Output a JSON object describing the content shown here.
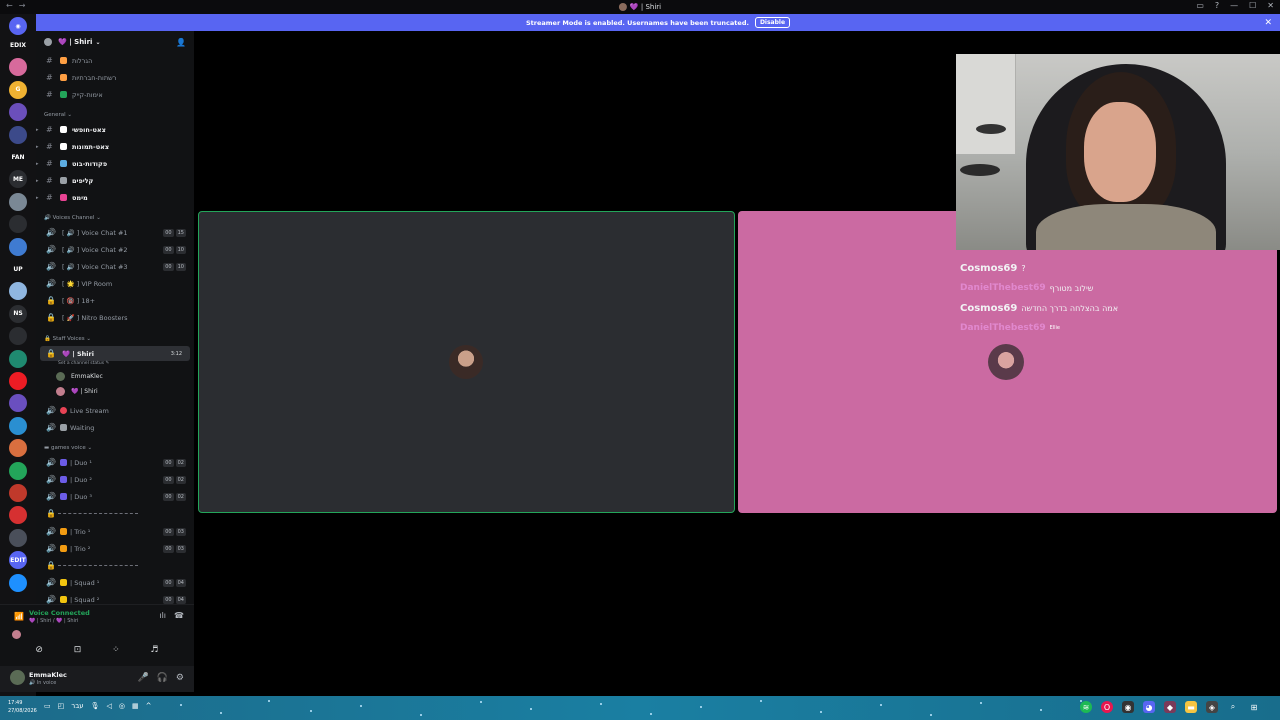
{
  "window": {
    "title": "💜 | Shiri",
    "controls": [
      "▭",
      "?",
      "—",
      "☐",
      "✕"
    ]
  },
  "banner": {
    "text": "Streamer Mode is enabled. Usernames have been truncated.",
    "button": "Disable"
  },
  "rail": {
    "servers": [
      {
        "label": "",
        "color": "#5865f2"
      },
      {
        "label": "EDIX",
        "color": "#121214"
      },
      {
        "label": "",
        "color": "#d76a9c"
      },
      {
        "label": "G",
        "color": "#f0b232"
      },
      {
        "label": "",
        "color": "#6b4fbb"
      },
      {
        "label": "",
        "color": "#3c4a8a"
      },
      {
        "label": "FAN",
        "color": "#121214"
      },
      {
        "label": "ME",
        "color": "#2b2d31"
      },
      {
        "label": "",
        "color": "#7a8895"
      },
      {
        "label": "",
        "color": "#2b2d31"
      },
      {
        "label": "",
        "color": "#3f7bd1"
      },
      {
        "label": "UP",
        "color": "#121214"
      },
      {
        "label": "",
        "color": "#8fb6e0"
      },
      {
        "label": "NS",
        "color": "#2b2d31"
      },
      {
        "label": "",
        "color": "#2b2d31"
      },
      {
        "label": "",
        "color": "#1f8a70"
      },
      {
        "label": "",
        "color": "#ed1c24"
      },
      {
        "label": "",
        "color": "#6a4fbf"
      },
      {
        "label": "",
        "color": "#2a8fd1"
      },
      {
        "label": "",
        "color": "#d96f3f"
      },
      {
        "label": "",
        "color": "#23a55a"
      },
      {
        "label": "",
        "color": "#c0392b"
      },
      {
        "label": "",
        "color": "#d63031"
      },
      {
        "label": "",
        "color": "#4a4f5a"
      },
      {
        "label": "EDIT",
        "color": "#5865f2"
      },
      {
        "label": "",
        "color": "#1e90ff"
      }
    ]
  },
  "server": {
    "name": "💜 | Shiri"
  },
  "channels": {
    "top": [
      {
        "label": "הגרלות",
        "color": "#ff9f43"
      },
      {
        "label": "רשתות-חברתיות",
        "color": "#ff9f43"
      },
      {
        "label": "אימות-קייק",
        "color": "#23a55a"
      }
    ],
    "general_cat": "General",
    "general": [
      {
        "label": "צאט-חופשי",
        "color": "#ffffff"
      },
      {
        "label": "צאט-תמונות",
        "color": "#ffffff"
      },
      {
        "label": "פקודות-בוט",
        "color": "#5dade2"
      },
      {
        "label": "קליפים",
        "color": "#9aa0a6"
      },
      {
        "label": "מימס",
        "color": "#e84393"
      }
    ],
    "voices_cat": "Voices Channel",
    "voices": [
      {
        "label": "[ 🔊 ] Voice Chat #1",
        "c1": "00",
        "c2": "15"
      },
      {
        "label": "[ 🔊 ] Voice Chat #2",
        "c1": "00",
        "c2": "10"
      },
      {
        "label": "[ 🔊 ] Voice Chat #3",
        "c1": "00",
        "c2": "10"
      },
      {
        "label": "[ 🌟 ] VIP Room",
        "c1": "",
        "c2": ""
      },
      {
        "label": "[ 🔞 ] 18+",
        "c1": "",
        "c2": ""
      },
      {
        "label": "[ 🚀 ] Nitro Boosters",
        "c1": "",
        "c2": ""
      }
    ],
    "staff_cat": "Staff Voices",
    "shiri": {
      "label": "💜 | Shiri",
      "time": "3:12",
      "status": "Set a channel status ✎"
    },
    "members": [
      "EmmaKlec",
      "💜 | Shiri"
    ],
    "live": "Live Stream",
    "waiting": "Waiting",
    "games_cat": "games voice",
    "games": [
      {
        "label": "| Duo ¹",
        "c1": "00",
        "c2": "02"
      },
      {
        "label": "| Duo ²",
        "c1": "00",
        "c2": "02"
      },
      {
        "label": "| Duo ³",
        "c1": "00",
        "c2": "02"
      },
      {
        "label": "| Trio ¹",
        "c1": "00",
        "c2": "03"
      },
      {
        "label": "| Trio ²",
        "c1": "00",
        "c2": "03"
      },
      {
        "label": "| Squad ¹",
        "c1": "00",
        "c2": "04"
      },
      {
        "label": "| Squad ²",
        "c1": "00",
        "c2": "04"
      }
    ]
  },
  "voice": {
    "status": "Voice Connected",
    "location": "💜 | Shiri / 💜 | Shiri"
  },
  "user": {
    "name": "EmmaKlec",
    "status": "🔊 In voice"
  },
  "chat": [
    {
      "user": "Cosmos69",
      "user_style": "u1",
      "message": "?"
    },
    {
      "user": "DanielThebest69",
      "user_style": "u2",
      "message": "שילוב מטורף"
    },
    {
      "user": "Cosmos69",
      "user_style": "u1",
      "message": "אמה בהצלחה בדרך החדשה"
    },
    {
      "user": "DanielThebest69",
      "user_style": "u2",
      "message": "Ellie"
    }
  ],
  "taskbar": {
    "time": "17:49",
    "date": "27/08/2026",
    "lang": "עבר"
  }
}
